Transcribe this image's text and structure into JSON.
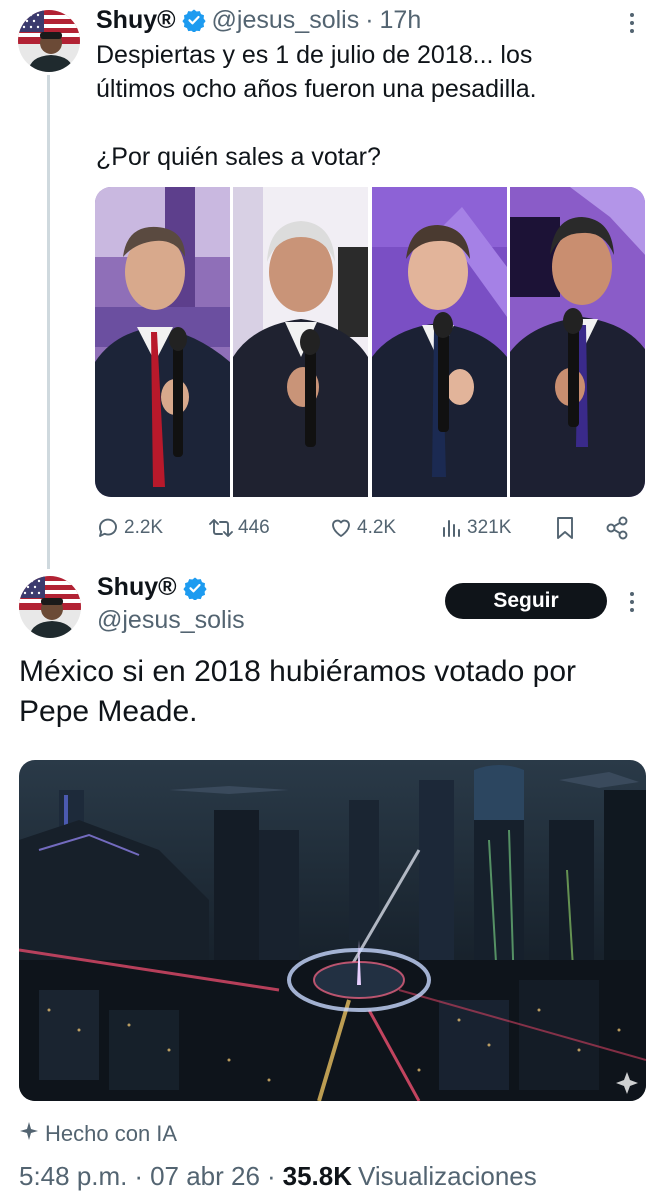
{
  "thread_tweet": {
    "display_name": "Shuy®",
    "handle": "@jesus_solis",
    "separator": "·",
    "time": "17h",
    "text": "Despiertas y es 1 de julio de 2018... los\núltimos ocho años fueron una pesadilla.\n\n¿Por quién sales a votar?",
    "actions": {
      "replies": "2.2K",
      "retweets": "446",
      "likes": "4.2K",
      "views": "321K"
    }
  },
  "main_tweet": {
    "display_name": "Shuy®",
    "handle": "@jesus_solis",
    "follow_label": "Seguir",
    "text": "México si en 2018 hubiéramos votado por Pepe Meade.",
    "ai_label": "Hecho con IA",
    "meta": {
      "time": "5:48 p.m.",
      "separator": "·",
      "date": "07 abr 26",
      "views_count": "35.8K",
      "views_label": "Visualizaciones"
    }
  },
  "icons": [
    "verified-badge-icon",
    "more-icon",
    "reply-icon",
    "retweet-icon",
    "like-icon",
    "views-icon",
    "bookmark-icon",
    "share-icon",
    "sparkle-icon"
  ],
  "colors": {
    "text_primary": "#0f1419",
    "text_secondary": "#536471",
    "verified_blue": "#1d9bf0",
    "follow_button_bg": "#0f1419",
    "thread_line": "#cfd9de"
  }
}
